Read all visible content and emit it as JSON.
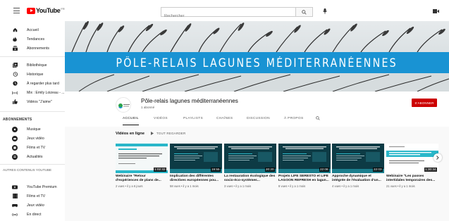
{
  "topbar": {
    "logo_text": "YouTube",
    "logo_suffix": "FR",
    "search_placeholder": "Rechercher"
  },
  "sidebar": {
    "main": [
      {
        "label": "Accueil",
        "icon": "home-icon"
      },
      {
        "label": "Tendances",
        "icon": "flame-icon"
      },
      {
        "label": "Abonnements",
        "icon": "subscriptions-icon"
      }
    ],
    "library": [
      {
        "label": "Bibliothèque",
        "icon": "library-icon"
      },
      {
        "label": "Historique",
        "icon": "history-icon"
      },
      {
        "label": "À regarder plus tard",
        "icon": "clock-icon"
      },
      {
        "label": "Mix : Emily Loizeau - ...",
        "icon": "mix-icon"
      },
      {
        "label": "Vidéos \"J'aime\"",
        "icon": "thumbs-up-icon"
      }
    ],
    "subscriptions_heading": "ABONNEMENTS",
    "subscriptions": [
      {
        "label": "Musique",
        "icon": "music-icon"
      },
      {
        "label": "Jeux vidéo",
        "icon": "gaming-icon"
      },
      {
        "label": "Films et TV",
        "icon": "film-icon"
      },
      {
        "label": "Actualités",
        "icon": "news-icon"
      }
    ],
    "more_heading": "AUTRES CONTENUS YOUTUBE",
    "more": [
      {
        "label": "YouTube Premium",
        "icon": "youtube-premium-icon"
      },
      {
        "label": "Films et TV",
        "icon": "film-icon"
      },
      {
        "label": "Jeux vidéo",
        "icon": "gaming-icon"
      },
      {
        "label": "En direct",
        "icon": "live-icon"
      }
    ]
  },
  "banner": {
    "title": "PÔLE-RELAIS LAGUNES MÉDITERRANÉENNES"
  },
  "channel": {
    "name": "Pôle-relais lagunes méditerranéennes",
    "subscribers": "1 abonné",
    "subscribe_label": "S'ABONNER"
  },
  "tabs": [
    "ACCUEIL",
    "VIDÉOS",
    "PLAYLISTS",
    "CHAÎNES",
    "DISCUSSION",
    "À PROPOS"
  ],
  "section": {
    "title": "Vidéos en ligne",
    "play_all": "TOUT REGARDER"
  },
  "videos": [
    {
      "title": "Webinaire \"Retour d'expériences de plans de...",
      "meta": "2 vues • il y a 6 jours",
      "duration": "1:02:32",
      "theme": "light"
    },
    {
      "title": "Implication des différentes directives européennes pou...",
      "meta": "58 vues • il y a 1 mois",
      "duration": "19:55",
      "theme": "dark"
    },
    {
      "title": "La restauration écologique des socio-éco-systèmes...",
      "meta": "3 vues • il y a 1 mois",
      "duration": "20:20",
      "theme": "dark"
    },
    {
      "title": "Projets LIFE SERESTO et LIFE LAGOON REFRESH en lagun...",
      "meta": "8 vues • il y a 1 mois",
      "duration": "22:08",
      "theme": "dark"
    },
    {
      "title": "Approche dynamique et intégrée de l'évaluation d'un...",
      "meta": "4 vues • il y a 1 mois",
      "duration": "22:03",
      "theme": "dark"
    },
    {
      "title": "Webinaire \"Les passes intertidales temporaires des...",
      "meta": "21 vues • il y a 1 mois",
      "duration": "1:30:34",
      "theme": "light2"
    }
  ],
  "colors": {
    "brand_red": "#ff0000",
    "subscribe_red": "#cc0000",
    "banner_blue": "#1993d3",
    "thumb_dark": "#0d3b45",
    "thumb_accent": "#2ab7c9"
  }
}
